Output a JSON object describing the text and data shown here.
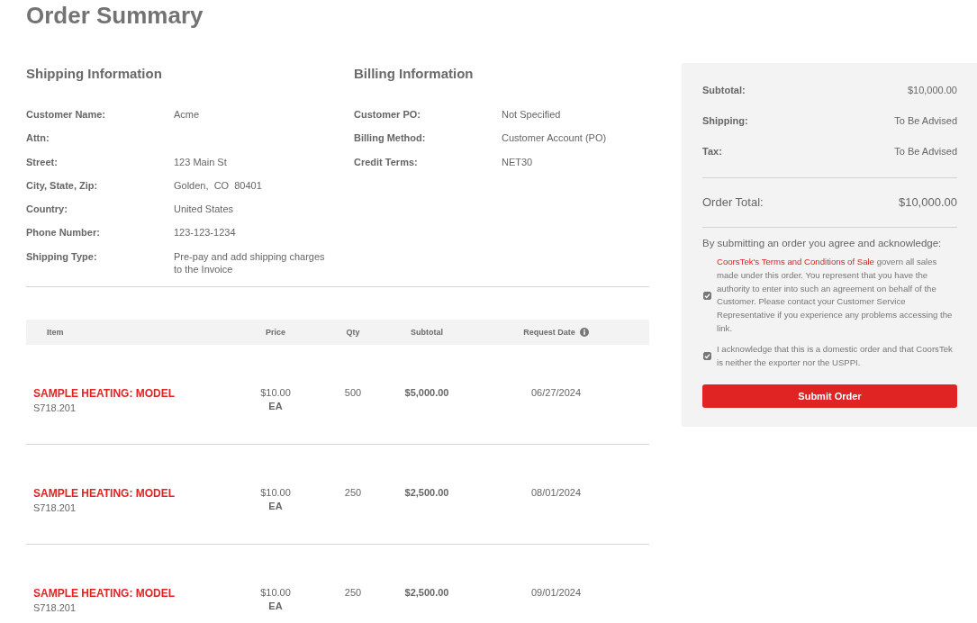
{
  "page_title": "Order Summary",
  "shipping": {
    "heading": "Shipping Information",
    "fields": [
      {
        "label": "Customer Name:",
        "value": "Acme"
      },
      {
        "label": "Attn:"
      },
      {
        "label": "Street:",
        "value": "123 Main St"
      },
      {
        "label": "City, State, Zip:",
        "value": "Golden,  CO  80401"
      },
      {
        "label": "Country:",
        "value": "United States"
      },
      {
        "label": "Phone Number:",
        "value": "123-123-1234"
      },
      {
        "label": "Shipping Type:",
        "value": "Pre-pay and add shipping charges to the Invoice"
      }
    ]
  },
  "billing": {
    "heading": "Billing Information",
    "fields": [
      {
        "label": "Customer PO:",
        "value": "Not Specified"
      },
      {
        "label": "Billing Method:",
        "value": "Customer Account (PO)"
      },
      {
        "label": "Credit Terms:",
        "value": "NET30"
      }
    ]
  },
  "table": {
    "columns": [
      {
        "label": "Item",
        "info": false
      },
      {
        "label": "Price",
        "info": false
      },
      {
        "label": "Qty",
        "info": false
      },
      {
        "label": "Subtotal",
        "info": false
      },
      {
        "label": "Request Date",
        "info": true
      }
    ],
    "rows": [
      {
        "name": "SAMPLE HEATING: MODEL",
        "sku": "S718.201",
        "price": "$10.00",
        "unit": "EA",
        "qty": "500",
        "subtotal": "$5,000.00",
        "request_date": "06/27/2024"
      },
      {
        "name": "SAMPLE HEATING: MODEL",
        "sku": "S718.201",
        "price": "$10.00",
        "unit": "EA",
        "qty": "250",
        "subtotal": "$2,500.00",
        "request_date": "08/01/2024"
      },
      {
        "name": "SAMPLE HEATING: MODEL",
        "sku": "S718.201",
        "price": "$10.00",
        "unit": "EA",
        "qty": "250",
        "subtotal": "$2,500.00",
        "request_date": "09/01/2024"
      }
    ]
  },
  "summary": {
    "lines": [
      {
        "label": "Subtotal:",
        "value": "$10,000.00"
      },
      {
        "label": "Shipping:",
        "value": "To Be Advised"
      },
      {
        "label": "Tax:",
        "value": "To Be Advised"
      }
    ],
    "total": {
      "label": "Order Total:",
      "value": "$10,000.00"
    },
    "agreement_intro": "By submitting an order you agree and acknowledge:",
    "agreements": [
      {
        "link": "CoorsTek's Terms and Conditions of Sale",
        "text": "govern all sales made under this order. You represent that you have the authority to enter into such an agreement on behalf of the Customer. Please contact your Customer Service Representative if you experience any problems accessing the link.",
        "checked": true
      },
      {
        "text": "I acknowledge that this is a domestic order and that CoorsTek is neither the exporter nor the USPPI.",
        "checked": true
      }
    ],
    "submit_button": "Submit Order"
  }
}
